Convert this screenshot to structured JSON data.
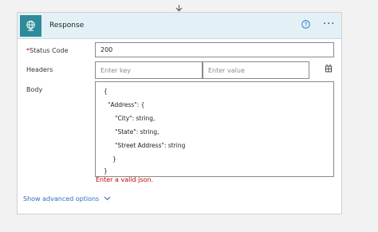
{
  "card": {
    "title": "Response"
  },
  "fields": {
    "status_code": {
      "required_mark": "*",
      "label": "Status Code",
      "value": "200"
    },
    "headers": {
      "label": "Headers",
      "key_placeholder": "Enter key",
      "value_placeholder": "Enter value"
    },
    "body": {
      "label": "Body",
      "lines": [
        "{",
        "\"Address\": {",
        "\"City\": string,",
        "\"State\": string,",
        "\"Street Address\": string",
        "}",
        "}"
      ],
      "error": "Enter a valid json."
    }
  },
  "footer": {
    "advanced_label": "Show advanced options"
  },
  "icons": {
    "app": "globe-icon",
    "help": "help-circle-icon",
    "more": "ellipsis-icon",
    "switch_mode": "table-switch-icon",
    "chevron": "chevron-down-icon"
  },
  "colors": {
    "header_bg": "#e3f1f6",
    "app_icon_bg": "#2e8b9a",
    "error": "#cc0000",
    "link": "#2b6fc2"
  }
}
